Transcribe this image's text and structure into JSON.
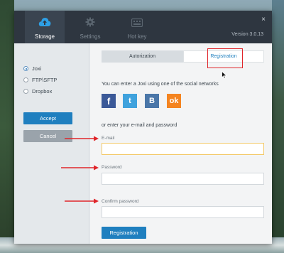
{
  "window": {
    "version": "Version 3.0.13",
    "close_glyph": "×"
  },
  "topbar": {
    "tabs": [
      {
        "label": "Storage",
        "icon": "cloud-upload-icon",
        "active": true
      },
      {
        "label": "Settings",
        "icon": "gear-icon",
        "active": false
      },
      {
        "label": "Hot key",
        "icon": "keyboard-icon",
        "active": false
      }
    ]
  },
  "storage": {
    "options": [
      {
        "label": "Joxi",
        "selected": true
      },
      {
        "label": "FTP\\SFTP",
        "selected": false
      },
      {
        "label": "Dropbox",
        "selected": false
      }
    ],
    "accept_label": "Accept",
    "cancel_label": "Cancel"
  },
  "auth": {
    "tabs": [
      {
        "label": "Autorization",
        "active": false
      },
      {
        "label": "Registration",
        "active": true
      }
    ],
    "social_text": "You can enter a Joxi using one of the social networks",
    "social_icons": [
      {
        "name": "facebook-icon",
        "glyph": "f",
        "color": "#3b5998"
      },
      {
        "name": "twitter-icon",
        "glyph": "t",
        "color": "#3fa2dd"
      },
      {
        "name": "vk-icon",
        "glyph": "B",
        "color": "#4a76a8"
      },
      {
        "name": "odnoklassniki-icon",
        "glyph": "ok",
        "color": "#f48420"
      }
    ],
    "or_text": "or enter your e-mail and password",
    "fields": [
      {
        "label": "E-mail",
        "value": "",
        "placeholder": ""
      },
      {
        "label": "Password",
        "value": "",
        "placeholder": ""
      },
      {
        "label": "Confirm password",
        "value": "",
        "placeholder": ""
      }
    ],
    "register_label": "Registration"
  },
  "colors": {
    "accent": "#1f7fbf",
    "annotation_red": "#e0252a",
    "topbar": "#2e3640"
  }
}
